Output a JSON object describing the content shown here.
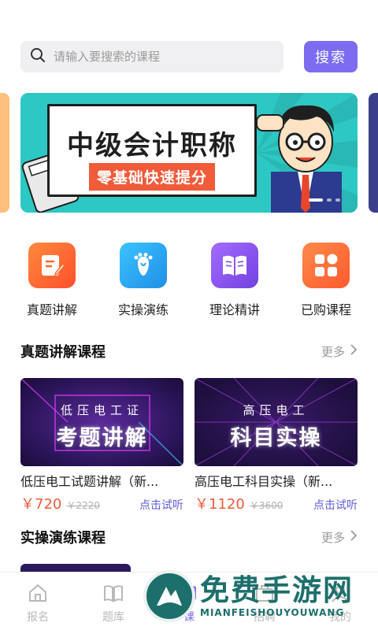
{
  "search": {
    "placeholder": "请输入要搜索的课程",
    "button_label": "搜索"
  },
  "banner": {
    "title": "中级会计职称",
    "subtitle": "零基础快速提分",
    "slide_count": 3,
    "active_slide": 1
  },
  "quick_nav": [
    {
      "label": "真题讲解",
      "icon": "edit-note-icon",
      "color": "#ff6a2b"
    },
    {
      "label": "实操演练",
      "icon": "footprint-icon",
      "color": "#2aa7f0"
    },
    {
      "label": "理论精讲",
      "icon": "book-icon",
      "color": "#8a5cf0"
    },
    {
      "label": "已购课程",
      "icon": "grid-icon",
      "color": "#ff6a3d"
    }
  ],
  "sections": [
    {
      "title": "真题讲解课程",
      "more_label": "更多"
    },
    {
      "title": "实操演练课程",
      "more_label": "更多"
    }
  ],
  "courses": [
    {
      "thumb_sub": "低压电工证",
      "thumb_main": "考题讲解",
      "title": "低压电工试题讲解（新...",
      "price": "￥720",
      "original_price": "￥2220",
      "trial_label": "点击试听"
    },
    {
      "thumb_sub": "高压电工",
      "thumb_main": "科目实操",
      "title": "高压电工科目实操（新...",
      "price": "￥1120",
      "original_price": "￥3600",
      "trial_label": "点击试听"
    }
  ],
  "bottom_nav": [
    {
      "label": "报名",
      "icon": "home-icon"
    },
    {
      "label": "题库",
      "icon": "book-open-icon"
    },
    {
      "label": "课",
      "icon": "course-icon"
    },
    {
      "label": "招聘",
      "icon": "briefcase-icon"
    },
    {
      "label": "我的",
      "icon": "user-icon"
    }
  ],
  "watermark": {
    "text": "免费手游网",
    "subtext": "MIANFEISHOUYOUWANG"
  },
  "colors": {
    "accent": "#7b6cf0",
    "price": "#f05b3a",
    "trial": "#5b5bd6",
    "banner_bg": "#2ec8c4"
  }
}
